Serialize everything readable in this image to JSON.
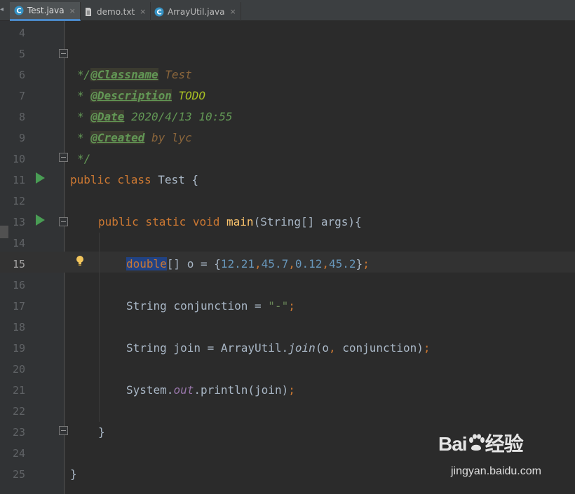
{
  "tabs": [
    {
      "label": "Test.java",
      "icon": "java-class-icon",
      "active": true
    },
    {
      "label": "demo.txt",
      "icon": "text-file-icon",
      "active": false
    },
    {
      "label": "ArrayUtil.java",
      "icon": "java-class-icon",
      "active": false
    }
  ],
  "tab_close_glyph": "×",
  "gutter": {
    "line_numbers": [
      "4",
      "5",
      "6",
      "7",
      "8",
      "9",
      "10",
      "11",
      "12",
      "13",
      "14",
      "15",
      "16",
      "17",
      "18",
      "19",
      "20",
      "21",
      "22",
      "23",
      "24",
      "25"
    ],
    "current_line": "15"
  },
  "code": {
    "l5": {
      "open": "/**"
    },
    "l6": {
      "star": "* ",
      "tag": "@Classname",
      "value": " Test"
    },
    "l7": {
      "star": "* ",
      "tag": "@Description",
      "value": " TODO"
    },
    "l8": {
      "star": "* ",
      "tag": "@Date",
      "value": " 2020/4/13 10:55"
    },
    "l9": {
      "star": "* ",
      "tag": "@Created",
      "value": " by lyc"
    },
    "l10": {
      "close": "*/"
    },
    "l11": {
      "kw": "public class ",
      "name": "Test ",
      "brace": "{"
    },
    "l13": {
      "kw": "public static void ",
      "method": "main",
      "rest": "(String[] args){"
    },
    "l15": {
      "type": "double",
      "rest": "[] o = {",
      "n1": "12.21",
      "c1": ",",
      "n2": "45.7",
      "c2": ",",
      "n3": "0.12",
      "c3": ",",
      "n4": "45.2",
      "end": "}",
      "semi": ";"
    },
    "l17": {
      "decl": "String conjunction = ",
      "str": "\"-\"",
      "semi": ";"
    },
    "l19": {
      "decl": "String join = ArrayUtil.",
      "call": "join",
      "args": "(o",
      "comma": ",",
      "args2": " conjunction)",
      "semi": ";"
    },
    "l21": {
      "cls": "System.",
      "field": "out",
      "call": ".println(join)",
      "semi": ";"
    },
    "l23": {
      "brace": "}"
    },
    "l25": {
      "brace": "}"
    }
  },
  "watermark": {
    "logo_left": "Bai",
    "logo_right": "经验",
    "url": "jingyan.baidu.com"
  },
  "colors": {
    "keyword": "#cc7832",
    "doc_comment": "#629755",
    "number": "#6897bb",
    "string": "#6a8759",
    "method": "#ffc66d",
    "static_field": "#9876aa",
    "run_gutter": "#499c54",
    "selection": "#214283"
  }
}
